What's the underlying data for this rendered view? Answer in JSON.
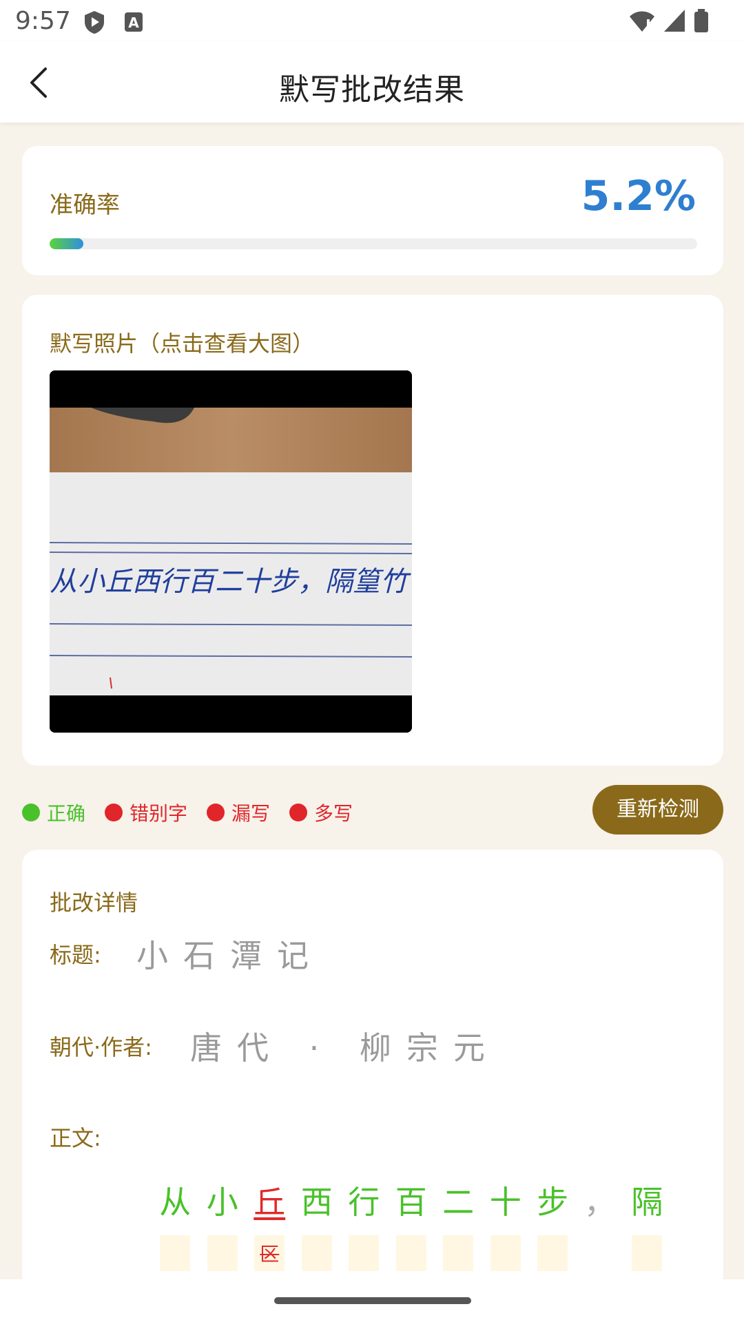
{
  "status": {
    "time": "9:57",
    "icons": [
      "play-protect-icon",
      "a-icon",
      "wifi-icon",
      "signal-icon",
      "battery-icon"
    ]
  },
  "header": {
    "title": "默写批改结果",
    "back_icon": "chevron-left-icon"
  },
  "accuracy": {
    "label": "准确率",
    "value": "5.2%",
    "fraction": 0.052
  },
  "photo": {
    "title": "默写照片（点击查看大图）",
    "handwriting": "从小丘西行百二十步，隔篁竹"
  },
  "legend": [
    {
      "label": "正确",
      "color": "#49c12a"
    },
    {
      "label": "错别字",
      "color": "#e0262b"
    },
    {
      "label": "漏写",
      "color": "#e0262b"
    },
    {
      "label": "多写",
      "color": "#e0262b"
    }
  ],
  "recheck_label": "重新检测",
  "detail": {
    "title": "批改详情",
    "title_label": "标题:",
    "title_chars": "小石潭记",
    "dynasty_label": "朝代·作者:",
    "dynasty_chars": "唐代 · 柳宗元",
    "body_label": "正文:",
    "body": [
      {
        "ch": "从",
        "state": "ok",
        "note": ""
      },
      {
        "ch": "小",
        "state": "ok",
        "note": ""
      },
      {
        "ch": "丘",
        "state": "err",
        "note": "区"
      },
      {
        "ch": "西",
        "state": "ok",
        "note": ""
      },
      {
        "ch": "行",
        "state": "ok",
        "note": ""
      },
      {
        "ch": "百",
        "state": "ok",
        "note": ""
      },
      {
        "ch": "二",
        "state": "ok",
        "note": ""
      },
      {
        "ch": "十",
        "state": "ok",
        "note": ""
      },
      {
        "ch": "步",
        "state": "ok",
        "note": ""
      },
      {
        "ch": "，",
        "state": "punc",
        "note": ""
      },
      {
        "ch": "隔",
        "state": "ok",
        "note": ""
      }
    ]
  }
}
